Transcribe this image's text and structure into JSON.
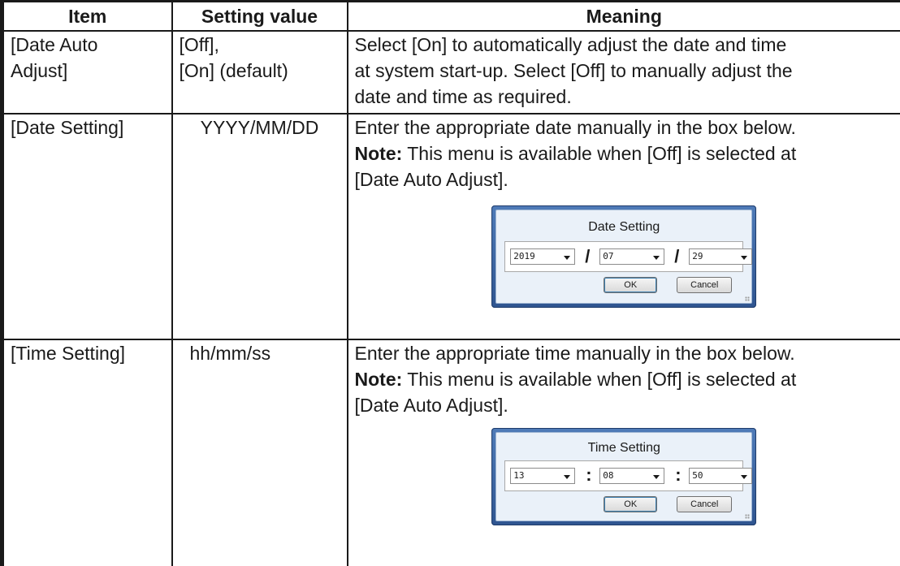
{
  "table": {
    "headers": [
      "Item",
      "Setting value",
      "Meaning"
    ],
    "rows": [
      {
        "item_lines": [
          "[Date Auto",
          "Adjust]"
        ],
        "value_lines": [
          "[Off],",
          "[On] (default)"
        ],
        "meaning_lines": [
          "Select [On] to automatically adjust the date and time",
          "at system start-up. Select [Off] to manually adjust the",
          "date and time as required."
        ]
      },
      {
        "item": "[Date Setting]",
        "value": "YYYY/MM/DD",
        "meaning_line1": "Enter the appropriate date manually in the box below.",
        "note_label": "Note:",
        "note_text": " This menu is available when [Off] is selected at",
        "note_line2": "[Date Auto Adjust].",
        "dialog": {
          "title": "Date Setting",
          "fields": [
            "2019",
            "07",
            "29"
          ],
          "separator": "/",
          "ok": "OK",
          "cancel": "Cancel"
        }
      },
      {
        "item": "[Time Setting]",
        "value": "hh/mm/ss",
        "meaning_line1": "Enter the appropriate time manually in the box below.",
        "note_label": "Note:",
        "note_text": " This menu is available when [Off] is selected at",
        "note_line2": "[Date Auto Adjust].",
        "dialog": {
          "title": "Time Setting",
          "fields": [
            "13",
            "08",
            "50"
          ],
          "separator": ":",
          "ok": "OK",
          "cancel": "Cancel"
        }
      }
    ]
  }
}
